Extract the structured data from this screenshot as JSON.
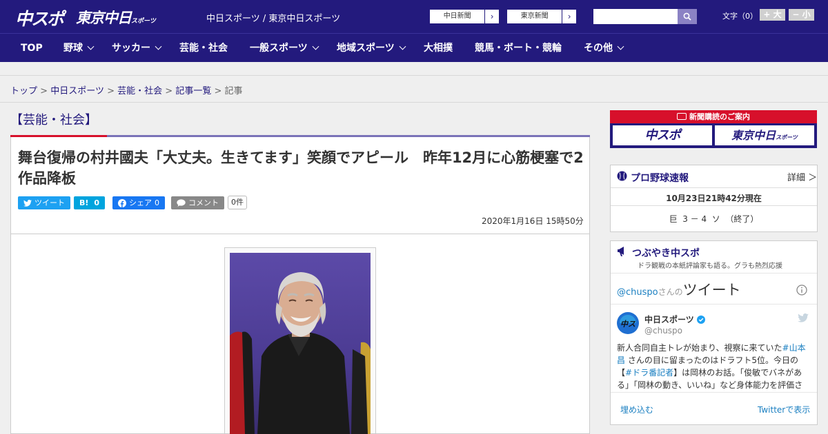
{
  "header": {
    "logo_chuspo": "中スポ",
    "logo_tokyo": "東京中日",
    "logo_tokyo_sub": "スポーツ",
    "site_links": "中日スポーツ / 東京中日スポーツ",
    "paper_chunichi": "中日新聞",
    "paper_tokyo": "東京新聞",
    "arrow": "›",
    "search_placeholder": "",
    "font_size_label": "文字（0）",
    "font_larger": "+ 大",
    "font_smaller": "− 小"
  },
  "nav": {
    "items": [
      "TOP",
      "野球",
      "サッカー",
      "芸能・社会",
      "一般スポーツ",
      "地域スポーツ",
      "大相撲",
      "競馬・ボート・競輪",
      "その他"
    ]
  },
  "breadcrumb": {
    "top": "トップ",
    "chunichi": "中日スポーツ",
    "category": "芸能・社会",
    "list": "記事一覧",
    "current": "記事",
    "sep": ">"
  },
  "article": {
    "category": "【芸能・社会】",
    "headline": "舞台復帰の村井國夫「大丈夫。生きてます」笑顔でアピール　昨年12月に心筋梗塞で2作品降板",
    "tweet_label": "ツイート",
    "hatena_label": "B!",
    "hatena_count": "0",
    "fb_label": "シェア",
    "fb_count": "0",
    "comment_label": "コメント",
    "comment_count": "0件",
    "date": "2020年1月16日 15時50分"
  },
  "sidebar": {
    "subscribe_title": "新聞購読のご案内",
    "subscribe_chuspo": "中スポ",
    "subscribe_tokyo": "東京中日",
    "subscribe_tokyo_sub": "スポーツ",
    "baseball_title": "プロ野球速報",
    "baseball_detail": "詳細 ＞",
    "baseball_time": "10月23日21時42分現在",
    "baseball_score": "巨  3 － 4  ソ  （終了）",
    "tsubuyaki_title": "つぶやき中スポ",
    "tsubuyaki_sub": "ドラ観戦の本紙評論家も語る。グラも熱烈応援",
    "tweets_account": "@chuspo",
    "tweets_suffix": "さんの",
    "tweets_heading": "ツイート",
    "tweet_user": "中日スポーツ",
    "tweet_handle": "@chuspo",
    "tweet_text_1": "新人合同自主トレが始まり、視察に来ていた",
    "tweet_tag_1": "#山本昌",
    "tweet_text_2": " さんの目に留まったのはドラフト5位。今日の【",
    "tweet_tag_2": "#ドラ番記者",
    "tweet_text_3": "】は岡林のお話。「俊敏でバネがある」「岡林の動き、いいね」など身体能力を評価さ",
    "embed_label": "埋め込む",
    "view_on_twitter": "Twitterで表示"
  },
  "colors": {
    "brand_navy": "#231a7d",
    "accent_red": "#d7102b",
    "twitter_blue": "#1da1f2",
    "facebook_blue": "#1877f2",
    "hatena_blue": "#00a4de"
  }
}
